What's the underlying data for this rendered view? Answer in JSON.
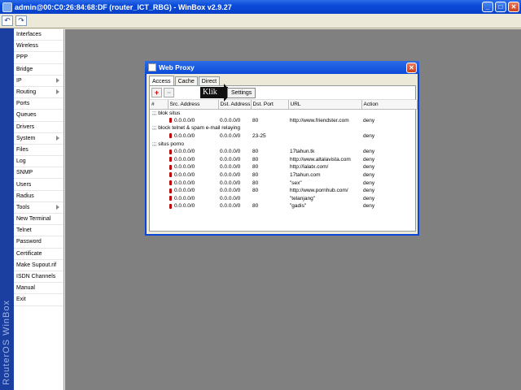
{
  "window": {
    "title": "admin@00:C0:26:84:68:DF (router_ICT_RBG) - WinBox v2.9.27",
    "minimize": "_",
    "maximize": "□",
    "close": "✕"
  },
  "toolbar": {
    "undo": "↶",
    "redo": "↷"
  },
  "brand": "RouterOS WinBox",
  "sidebar": {
    "items": [
      {
        "label": "Interfaces",
        "submenu": false
      },
      {
        "label": "Wireless",
        "submenu": false
      },
      {
        "label": "PPP",
        "submenu": false
      },
      {
        "label": "Bridge",
        "submenu": false
      },
      {
        "label": "IP",
        "submenu": true
      },
      {
        "label": "Routing",
        "submenu": true
      },
      {
        "label": "Ports",
        "submenu": false
      },
      {
        "label": "Queues",
        "submenu": false
      },
      {
        "label": "Drivers",
        "submenu": false
      },
      {
        "label": "System",
        "submenu": true
      },
      {
        "label": "Files",
        "submenu": false
      },
      {
        "label": "Log",
        "submenu": false
      },
      {
        "label": "SNMP",
        "submenu": false
      },
      {
        "label": "Users",
        "submenu": false
      },
      {
        "label": "Radius",
        "submenu": false
      },
      {
        "label": "Tools",
        "submenu": true
      },
      {
        "label": "New Terminal",
        "submenu": false
      },
      {
        "label": "Telnet",
        "submenu": false
      },
      {
        "label": "Password",
        "submenu": false
      },
      {
        "label": "Certificate",
        "submenu": false
      },
      {
        "label": "Make Supout.rif",
        "submenu": false
      },
      {
        "label": "ISDN Channels",
        "submenu": false
      },
      {
        "label": "Manual",
        "submenu": false
      },
      {
        "label": "Exit",
        "submenu": false
      }
    ]
  },
  "web_proxy": {
    "title": "Web Proxy",
    "close": "✕",
    "tabs": [
      "Access",
      "Cache",
      "Direct"
    ],
    "add": "+",
    "remove": "−",
    "settings_label": "Settings",
    "annotation": "Klik",
    "columns": [
      "#",
      "Src. Address",
      "Dst. Address",
      "Dst. Port",
      "URL",
      "Action"
    ],
    "rows": [
      {
        "type": "comment",
        "text": ";;; blok situs"
      },
      {
        "type": "rule",
        "src": "0.0.0.0/0",
        "dst": "0.0.0.0/0",
        "port": "80",
        "url": "http://www.friendster.com",
        "action": "deny"
      },
      {
        "type": "comment",
        "text": ";;; block telnet & spam e-mail relaying"
      },
      {
        "type": "rule",
        "src": "0.0.0.0/0",
        "dst": "0.0.0.0/0",
        "port": "23-25",
        "url": "",
        "action": "deny"
      },
      {
        "type": "comment",
        "text": ";;; situs porno"
      },
      {
        "type": "rule",
        "src": "0.0.0.0/0",
        "dst": "0.0.0.0/0",
        "port": "80",
        "url": "17tahun.tk",
        "action": "deny"
      },
      {
        "type": "rule",
        "src": "0.0.0.0/0",
        "dst": "0.0.0.0/0",
        "port": "80",
        "url": "http://www.altalavista.com",
        "action": "deny"
      },
      {
        "type": "rule",
        "src": "0.0.0.0/0",
        "dst": "0.0.0.0/0",
        "port": "80",
        "url": "http://lalatx.com/",
        "action": "deny"
      },
      {
        "type": "rule",
        "src": "0.0.0.0/0",
        "dst": "0.0.0.0/0",
        "port": "80",
        "url": "17tahun.com",
        "action": "deny"
      },
      {
        "type": "rule",
        "src": "0.0.0.0/0",
        "dst": "0.0.0.0/0",
        "port": "80",
        "url": "\"sex\"",
        "action": "deny"
      },
      {
        "type": "rule",
        "src": "0.0.0.0/0",
        "dst": "0.0.0.0/0",
        "port": "80",
        "url": "http://www.pornhub.com/",
        "action": "deny"
      },
      {
        "type": "rule",
        "src": "0.0.0.0/0",
        "dst": "0.0.0.0/0",
        "port": "",
        "url": "\"telanjang\"",
        "action": "deny"
      },
      {
        "type": "rule",
        "src": "0.0.0.0/0",
        "dst": "0.0.0.0/0",
        "port": "80",
        "url": "\"gadis\"",
        "action": "deny"
      }
    ]
  }
}
